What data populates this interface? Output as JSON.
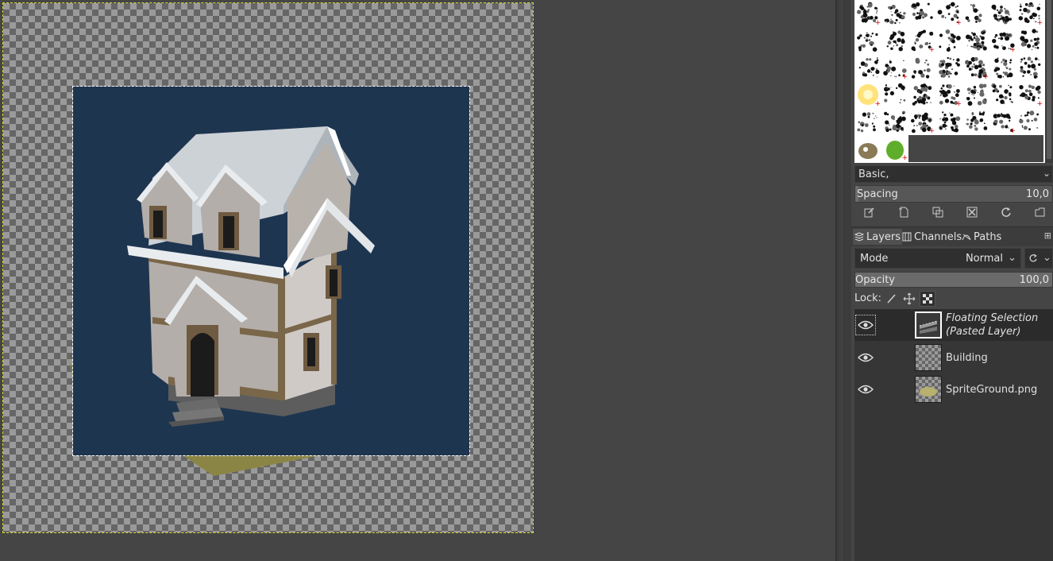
{
  "canvas": {
    "colors": {
      "pasted_layer_bg": "#1e3550",
      "ground": "#8a8545",
      "selection_outline": "#d6d639"
    }
  },
  "brushes": {
    "count": 42,
    "icons": [
      "brush-texture",
      "brush-splatter",
      "brush-hatched",
      "brush-blob",
      "brush-oval",
      "brush-crosshatch",
      "brush-specks",
      "brush-leaf",
      "brush-arrows",
      "brush-sponge",
      "brush-grunge",
      "brush-strokes",
      "brush-spatter",
      "brush-smoke",
      "brush-dots",
      "brush-line",
      "brush-drop",
      "brush-dot",
      "brush-pencil",
      "brush-diagonal",
      "brush-cloud",
      "brush-glow",
      "brush-particles",
      "brush-scratch",
      "brush-circle",
      "brush-spray",
      "brush-grass",
      "brush-dust",
      "brush-star",
      "brush-ink",
      "brush-stripes",
      "brush-flower",
      "brush-burst",
      "brush-hair",
      "brush-vine",
      "gimp-mascot",
      "green-pepper",
      "",
      "",
      "",
      "",
      ""
    ]
  },
  "brush_preset": {
    "value": "Basic,"
  },
  "spacing": {
    "label": "Spacing",
    "value": "10,0",
    "fraction": 0.1
  },
  "brush_actions": [
    "edit-brush-icon",
    "new-brush-icon",
    "duplicate-brush-icon",
    "delete-brush-icon",
    "refresh-brush-icon",
    "open-brush-folder-icon"
  ],
  "tabs": [
    {
      "label": "Layers",
      "icon": "layers-icon",
      "active": true
    },
    {
      "label": "Channels",
      "icon": "channels-icon",
      "active": false
    },
    {
      "label": "Paths",
      "icon": "paths-icon",
      "active": false
    }
  ],
  "mode": {
    "label": "Mode",
    "value": "Normal"
  },
  "opacity": {
    "label": "Opacity",
    "value": "100,0",
    "fraction": 1.0
  },
  "lock": {
    "label": "Lock:",
    "icons": [
      "lock-pixels-icon",
      "lock-position-icon",
      "lock-alpha-icon"
    ]
  },
  "layers": [
    {
      "name_line1": "Floating Selection",
      "name_line2": "(Pasted Layer)",
      "visible": true,
      "selected": true
    },
    {
      "name_line1": "Building",
      "name_line2": "",
      "visible": true,
      "selected": false
    },
    {
      "name_line1": "SpriteGround.png",
      "name_line2": "",
      "visible": true,
      "selected": false
    }
  ]
}
